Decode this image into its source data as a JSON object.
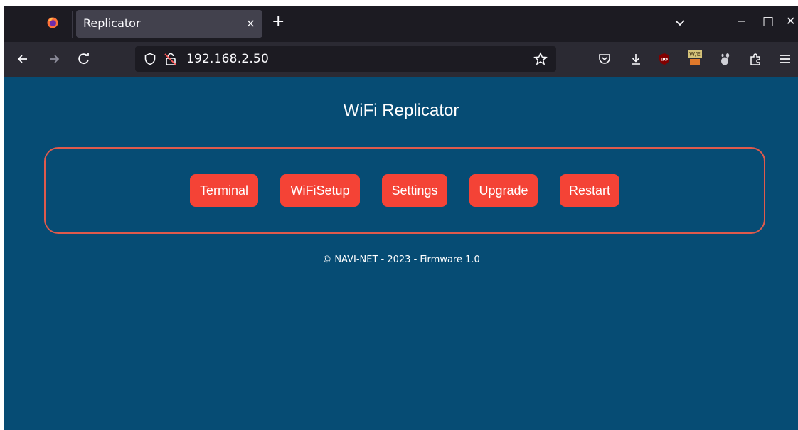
{
  "browser": {
    "tab_title": "Replicator",
    "tab_close": "×",
    "new_tab": "+",
    "url": "192.168.2.50",
    "window_controls": {
      "minimize": "−",
      "maximize": "□",
      "close": "✕"
    },
    "icons": [
      "firefox-logo-icon",
      "back-icon",
      "forward-icon",
      "reload-icon",
      "shield-icon",
      "insecure-lock-icon",
      "bookmark-star-icon",
      "pocket-icon",
      "download-icon",
      "ublock-icon",
      "wappalyzer-icon",
      "gnome-extension-icon",
      "extensions-icon",
      "menu-icon",
      "tab-list-icon"
    ]
  },
  "page": {
    "title": "WiFi Replicator",
    "buttons": [
      {
        "label": "Terminal"
      },
      {
        "label": "WiFiSetup"
      },
      {
        "label": "Settings"
      },
      {
        "label": "Upgrade"
      },
      {
        "label": "Restart"
      }
    ],
    "footer": "© NAVI-NET - 2023 - Firmware 1.0"
  },
  "colors": {
    "background": "#064c74",
    "button": "#f44336",
    "panel_border": "#e05a4c"
  }
}
